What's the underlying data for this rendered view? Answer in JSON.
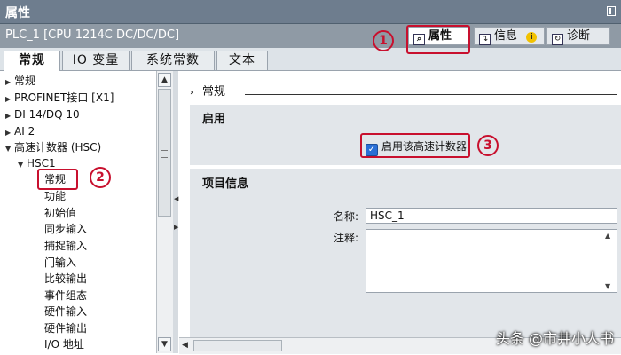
{
  "title": "属性",
  "device": "PLC_1 [CPU 1214C DC/DC/DC]",
  "panel_tabs": [
    {
      "label": "属性",
      "icon": "properties-icon"
    },
    {
      "label": "信息",
      "icon": "info-icon"
    },
    {
      "label": "诊断",
      "icon": "diagnostics-icon"
    }
  ],
  "info_badge": "i",
  "tabs": [
    "常规",
    "IO 变量",
    "系统常数",
    "文本"
  ],
  "tree": [
    {
      "label": "常规"
    },
    {
      "label": "PROFINET接口 [X1]"
    },
    {
      "label": "DI 14/DQ 10"
    },
    {
      "label": "AI 2"
    },
    {
      "label": "高速计数器 (HSC)"
    },
    {
      "label": "HSC1"
    },
    {
      "label": "常规"
    },
    {
      "label": "功能"
    },
    {
      "label": "初始值"
    },
    {
      "label": "同步输入"
    },
    {
      "label": "捕捉输入"
    },
    {
      "label": "门输入"
    },
    {
      "label": "比较输出"
    },
    {
      "label": "事件组态"
    },
    {
      "label": "硬件输入"
    },
    {
      "label": "硬件输出"
    },
    {
      "label": "I/O 地址"
    }
  ],
  "main": {
    "breadcrumb": "常规",
    "enable_section": "启用",
    "enable_checkbox_label": "启用该高速计数器",
    "enable_checked": true,
    "project_section": "项目信息",
    "name_label": "名称:",
    "name_value": "HSC_1",
    "comment_label": "注释:",
    "comment_value": ""
  },
  "annotations": [
    "1",
    "2",
    "3"
  ],
  "watermark": "头条 @市井小人书",
  "colors": {
    "annotation": "#c8102e",
    "titlebar": "#6e7d8e"
  }
}
